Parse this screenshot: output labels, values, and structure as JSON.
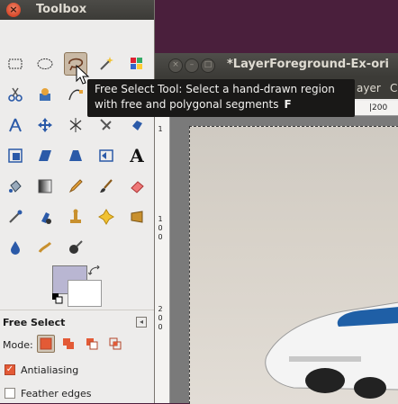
{
  "toolbox": {
    "title": "Toolbox",
    "close_icon": "close-icon",
    "tools": [
      {
        "name": "rect-select-tool",
        "icon": "rect-select-icon"
      },
      {
        "name": "ellipse-select-tool",
        "icon": "ellipse-select-icon"
      },
      {
        "name": "free-select-tool",
        "icon": "lasso-icon",
        "active": true
      },
      {
        "name": "fuzzy-select-tool",
        "icon": "magic-wand-icon"
      },
      {
        "name": "select-by-color-tool",
        "icon": "select-by-color-icon"
      },
      {
        "name": "scissors-select-tool",
        "icon": "scissors-icon"
      },
      {
        "name": "foreground-select-tool",
        "icon": "foreground-select-icon"
      },
      {
        "name": "paths-tool",
        "icon": "paths-icon"
      },
      {
        "name": "color-picker-tool",
        "icon": "color-picker-icon"
      },
      {
        "name": "zoom-tool",
        "icon": "zoom-icon"
      },
      {
        "name": "measure-tool",
        "icon": "compass-icon"
      },
      {
        "name": "move-tool",
        "icon": "move-icon"
      },
      {
        "name": "align-tool",
        "icon": "align-icon"
      },
      {
        "name": "crop-tool",
        "icon": "crop-icon"
      },
      {
        "name": "rotate-tool",
        "icon": "rotate-icon"
      },
      {
        "name": "scale-tool",
        "icon": "scale-icon"
      },
      {
        "name": "shear-tool",
        "icon": "shear-icon"
      },
      {
        "name": "perspective-tool",
        "icon": "perspective-icon"
      },
      {
        "name": "flip-tool",
        "icon": "flip-icon"
      },
      {
        "name": "text-tool",
        "icon": "text-icon"
      },
      {
        "name": "bucket-fill-tool",
        "icon": "bucket-icon"
      },
      {
        "name": "blend-tool",
        "icon": "gradient-icon"
      },
      {
        "name": "pencil-tool",
        "icon": "pencil-icon"
      },
      {
        "name": "paintbrush-tool",
        "icon": "paintbrush-icon"
      },
      {
        "name": "eraser-tool",
        "icon": "eraser-icon"
      },
      {
        "name": "airbrush-tool",
        "icon": "airbrush-icon"
      },
      {
        "name": "ink-tool",
        "icon": "ink-icon"
      },
      {
        "name": "clone-tool",
        "icon": "clone-stamp-icon"
      },
      {
        "name": "heal-tool",
        "icon": "heal-icon"
      },
      {
        "name": "perspective-clone-tool",
        "icon": "perspective-clone-icon"
      },
      {
        "name": "blur-sharpen-tool",
        "icon": "blur-icon"
      },
      {
        "name": "smudge-tool",
        "icon": "smudge-icon"
      },
      {
        "name": "dodge-burn-tool",
        "icon": "dodge-burn-icon"
      }
    ],
    "colors": {
      "foreground": "#b9b6d2",
      "background": "#ffffff"
    }
  },
  "tool_options": {
    "title": "Free Select",
    "mode_label": "Mode:",
    "modes": [
      "replace",
      "add",
      "subtract",
      "intersect"
    ],
    "antialiasing_label": "Antialiasing",
    "antialiasing_checked": true,
    "feather_label": "Feather edges",
    "feather_checked": false
  },
  "image_window": {
    "title": "*LayerForeground-Ex-ori",
    "menu": [
      "ayer",
      "C"
    ],
    "ruler_top_label": "|200",
    "ruler_left_labels": [
      "1",
      "0",
      "0",
      "2",
      "0",
      "0"
    ]
  },
  "tooltip": {
    "text": "Free Select Tool: Select a hand-drawn region with free and polygonal segments",
    "shortcut": "F"
  },
  "accent_colors": {
    "active_tool": "#c9b9a5",
    "close_button": "#d7482a",
    "title_bar": "#3c3b37"
  }
}
